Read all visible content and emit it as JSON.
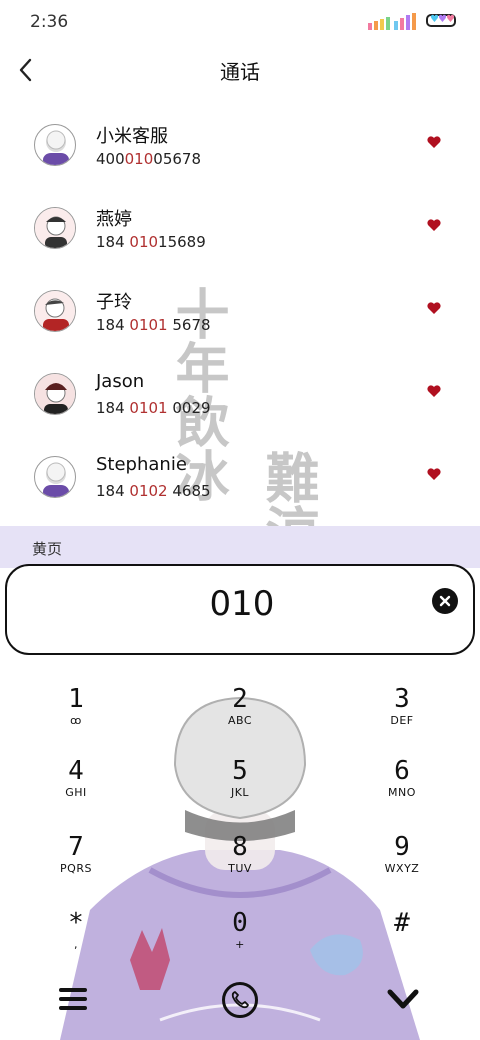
{
  "status_bar": {
    "time": "2:36",
    "signal_icon": "signal-bars-icon",
    "battery_icon": "battery-icon"
  },
  "header": {
    "title": "通话",
    "back_icon": "back-arrow-icon"
  },
  "watermark": {
    "text_a": "十年飲冰",
    "text_b": "難涼"
  },
  "contacts": [
    {
      "name": "小米客服",
      "number_pre": "400",
      "number_hl": "010",
      "number_post": "05678",
      "avatar_colors": [
        "#ffffff",
        "#6b4ca8"
      ]
    },
    {
      "name": "燕婷",
      "number_pre": "184 ",
      "number_hl": "010",
      "number_post": "15689",
      "avatar_colors": [
        "#f4dada",
        "#333333"
      ]
    },
    {
      "name": "子玲",
      "number_pre": "184 ",
      "number_hl": "0101",
      "number_post": " 5678",
      "avatar_colors": [
        "#f4dada",
        "#b32525"
      ]
    },
    {
      "name": "Jason",
      "number_pre": "184 ",
      "number_hl": "0101",
      "number_post": " 0029",
      "avatar_colors": [
        "#f0d6d6",
        "#5a1f1f"
      ]
    },
    {
      "name": "Stephanie",
      "number_pre": "184 ",
      "number_hl": "0102",
      "number_post": " 4685",
      "avatar_colors": [
        "#ffffff",
        "#6b4ca8"
      ]
    }
  ],
  "favorite_icon": "heart-icon",
  "favorite_color": "#b01020",
  "yellow_pages": {
    "label": "黄页",
    "band_color": "#e6e2f6"
  },
  "dial": {
    "value": "010",
    "clear_icon": "close-icon"
  },
  "keypad": [
    {
      "digit": "1",
      "letters": "ꝏ"
    },
    {
      "digit": "2",
      "letters": "ABC"
    },
    {
      "digit": "3",
      "letters": "DEF"
    },
    {
      "digit": "4",
      "letters": "GHI"
    },
    {
      "digit": "5",
      "letters": "JKL"
    },
    {
      "digit": "6",
      "letters": "MNO"
    },
    {
      "digit": "7",
      "letters": "PQRS"
    },
    {
      "digit": "8",
      "letters": "TUV"
    },
    {
      "digit": "9",
      "letters": "WXYZ"
    },
    {
      "digit": "*",
      "letters": ","
    },
    {
      "digit": "0",
      "letters": "+"
    },
    {
      "digit": "#",
      "letters": ""
    }
  ],
  "bottom_bar": {
    "menu_icon": "menu-icon",
    "call_icon": "phone-icon",
    "collapse_icon": "chevron-down-icon"
  }
}
